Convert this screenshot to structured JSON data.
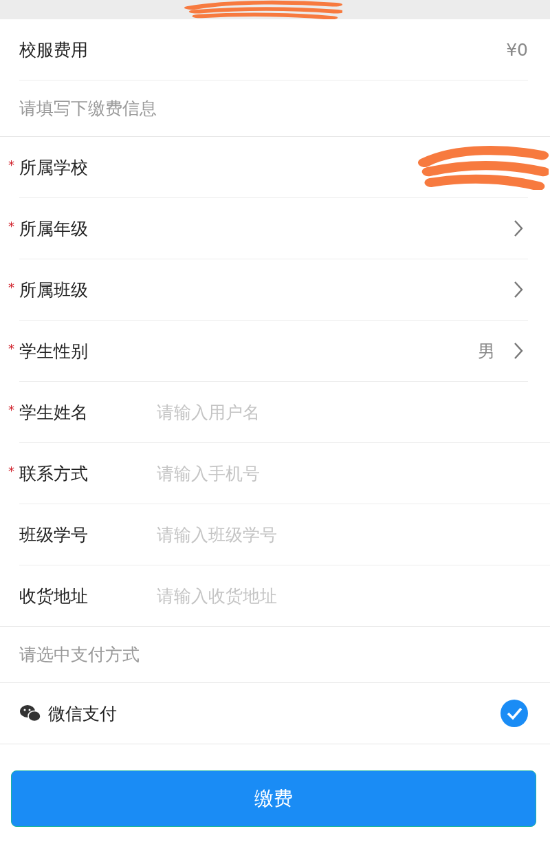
{
  "top_bar": {
    "redacted": true
  },
  "fee": {
    "label": "校服费用",
    "value": "¥0"
  },
  "info_header": "请填写下缴费信息",
  "fields": [
    {
      "kind": "select",
      "label": "所属学校",
      "required_mark": "*",
      "redacted": true
    },
    {
      "kind": "select",
      "label": "所属年级",
      "required_mark": "*",
      "redacted": false
    },
    {
      "kind": "select",
      "label": "所属班级",
      "required_mark": "*",
      "redacted": false
    },
    {
      "kind": "select",
      "label": "学生性别",
      "required_mark": "*",
      "redacted": false,
      "value": "男"
    },
    {
      "kind": "input",
      "label": "学生姓名",
      "required_mark": "*",
      "placeholder": "请输入用户名"
    },
    {
      "kind": "input",
      "label": "联系方式",
      "required_mark": "*",
      "placeholder": "请输入手机号"
    },
    {
      "kind": "input",
      "label": "班级学号",
      "placeholder": "请输入班级学号"
    },
    {
      "kind": "input",
      "label": "收货地址",
      "placeholder": "请输入收货地址"
    }
  ],
  "payment_header": "请选中支付方式",
  "payments": [
    {
      "label": "微信支付",
      "selected": true
    }
  ],
  "submit": "缴费"
}
